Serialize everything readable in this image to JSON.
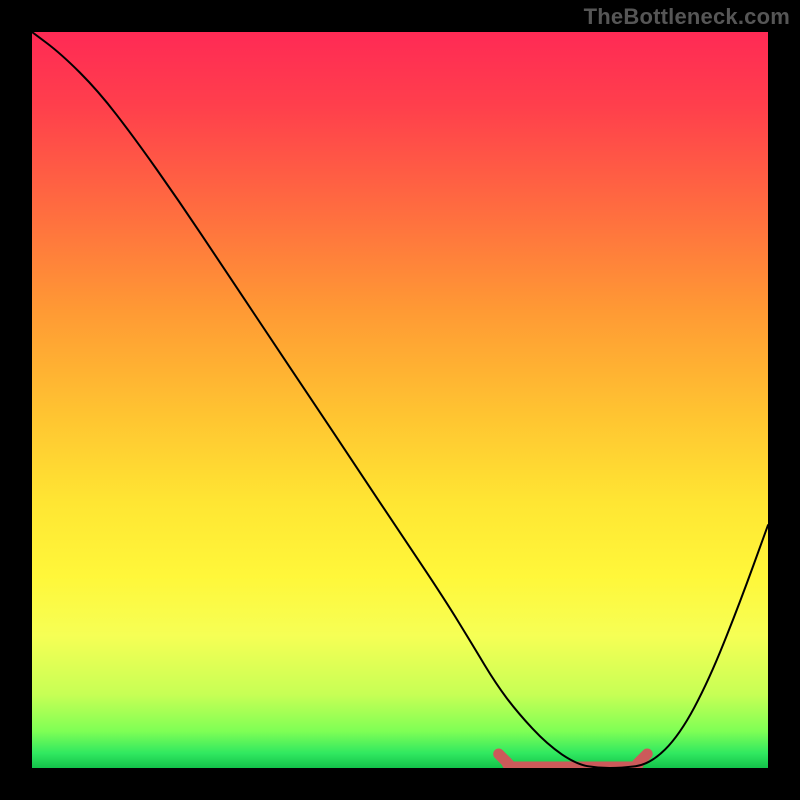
{
  "watermark": "TheBottleneck.com",
  "colors": {
    "background": "#000000",
    "curve": "#000000",
    "flat_highlight": "#cc5a5a",
    "gradient_top": "#ff2a55",
    "gradient_bottom": "#13c24a"
  },
  "chart_data": {
    "type": "line",
    "title": "",
    "xlabel": "",
    "ylabel": "",
    "xlim": [
      0,
      100
    ],
    "ylim": [
      0,
      100
    ],
    "grid": false,
    "legend": false,
    "annotations": [],
    "series": [
      {
        "name": "bottleneck-curve",
        "x": [
          0,
          4,
          9,
          14,
          20,
          26,
          32,
          38,
          44,
          50,
          56,
          60,
          63,
          66,
          70,
          74,
          77,
          80,
          84,
          88,
          92,
          96,
          100
        ],
        "y": [
          100,
          97,
          92,
          85.5,
          77,
          68,
          59,
          50,
          41,
          32,
          23,
          16.5,
          11.5,
          7.5,
          3.2,
          0.5,
          0,
          0,
          0.5,
          4.5,
          12,
          22,
          33
        ]
      }
    ],
    "flat_region": {
      "x_start": 63,
      "x_end": 84,
      "y": 0
    }
  }
}
